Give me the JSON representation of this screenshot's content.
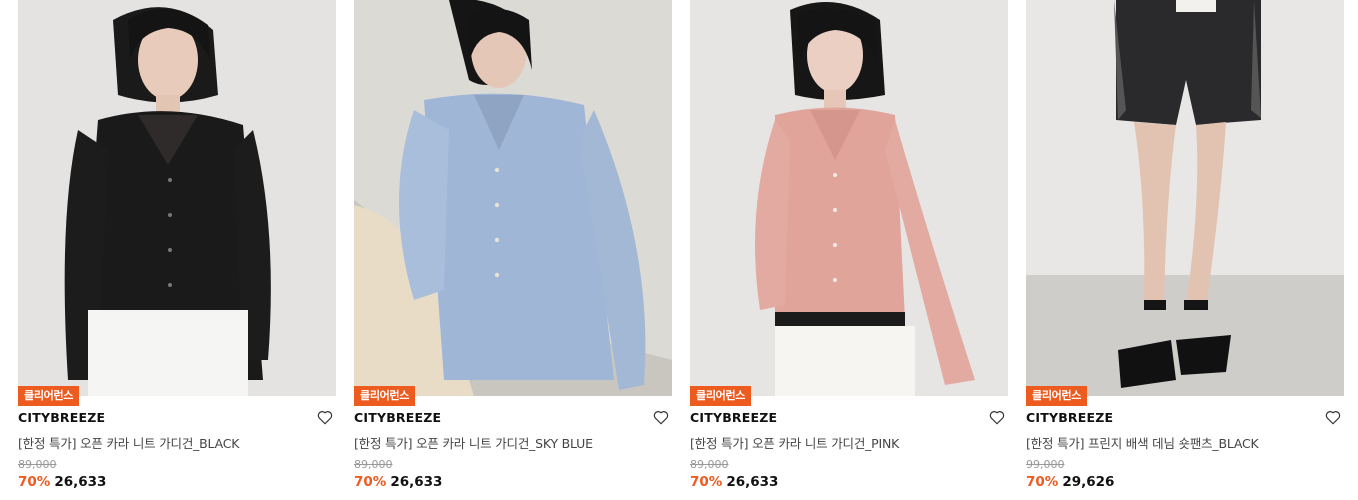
{
  "products": [
    {
      "badge": "클리어런스",
      "brand": "CITYBREEZE",
      "name": "[한정 특가] 오픈 카라 니트 가디건_BLACK",
      "original_price": "89,000",
      "discount": "70%",
      "sale_price": "26,633",
      "garment_color": "#1b1a1a",
      "background_color": "#e9e8e6"
    },
    {
      "badge": "클리어런스",
      "brand": "CITYBREEZE",
      "name": "[한정 특가] 오픈 카라 니트 가디건_SKY BLUE",
      "original_price": "89,000",
      "discount": "70%",
      "sale_price": "26,633",
      "garment_color": "#9fb6d6",
      "background_color": "#dcdad5"
    },
    {
      "badge": "클리어런스",
      "brand": "CITYBREEZE",
      "name": "[한정 특가] 오픈 카라 니트 가디건_PINK",
      "original_price": "89,000",
      "discount": "70%",
      "sale_price": "26,633",
      "garment_color": "#e0a49b",
      "background_color": "#e6e5e3"
    },
    {
      "badge": "클리어런스",
      "brand": "CITYBREEZE",
      "name": "[한정 특가] 프린지 배색 데님 숏팬츠_BLACK",
      "original_price": "99,000",
      "discount": "70%",
      "sale_price": "29,626",
      "garment_color": "#2a2a2c",
      "background_color": "#e8e7e5"
    }
  ],
  "colors": {
    "accent": "#ee5b1f",
    "text": "#111111",
    "muted": "#999999"
  },
  "icons": {
    "wishlist": "heart-outline-icon"
  }
}
